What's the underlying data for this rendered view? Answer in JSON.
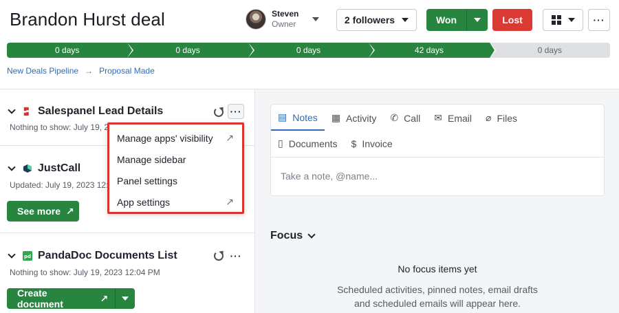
{
  "deal": {
    "title": "Brandon Hurst deal"
  },
  "owner": {
    "name": "Steven",
    "role": "Owner"
  },
  "header": {
    "followers_label": "2 followers",
    "won_label": "Won",
    "lost_label": "Lost",
    "more_label": "···"
  },
  "stages": [
    {
      "label": "0 days",
      "status": "done"
    },
    {
      "label": "0 days",
      "status": "done"
    },
    {
      "label": "0 days",
      "status": "done"
    },
    {
      "label": "42 days",
      "status": "done"
    },
    {
      "label": "0 days",
      "status": "todo"
    }
  ],
  "breadcrumb": {
    "pipeline": "New Deals Pipeline",
    "separator": "→",
    "stage": "Proposal Made"
  },
  "sidebar": {
    "sections": [
      {
        "title": "Salespanel Lead Details",
        "subtitle": "Nothing to show: July 19, 2023 12:04 PM",
        "icon_color": "#d6342e"
      },
      {
        "title": "JustCall",
        "subtitle": "Updated: July 19, 2023 12:04 PM",
        "button": "See more",
        "icon_color": "#1f3a5f"
      },
      {
        "title": "PandaDoc Documents List",
        "subtitle": "Nothing to show: July 19, 2023 12:04 PM",
        "button": "Create document",
        "icon_color": "#2fa84f"
      }
    ],
    "more_label": "···",
    "external_glyph": "↗"
  },
  "menu": {
    "items": [
      {
        "label": "Manage apps' visibility",
        "external": true
      },
      {
        "label": "Manage sidebar",
        "external": false
      },
      {
        "label": "Panel settings",
        "external": false
      },
      {
        "label": "App settings",
        "external": true
      }
    ]
  },
  "composer": {
    "tabs": [
      {
        "label": "Notes",
        "icon": "note-icon",
        "glyph": "▤",
        "active": true
      },
      {
        "label": "Activity",
        "icon": "calendar-icon",
        "glyph": "▦",
        "active": false
      },
      {
        "label": "Call",
        "icon": "phone-icon",
        "glyph": "✆",
        "active": false
      },
      {
        "label": "Email",
        "icon": "envelope-icon",
        "glyph": "✉",
        "active": false
      },
      {
        "label": "Files",
        "icon": "paperclip-icon",
        "glyph": "⌀",
        "active": false
      },
      {
        "label": "Documents",
        "icon": "document-icon",
        "glyph": "▯",
        "active": false
      },
      {
        "label": "Invoice",
        "icon": "invoice-icon",
        "glyph": "$",
        "active": false
      }
    ],
    "placeholder": "Take a note, @name..."
  },
  "focus": {
    "title": "Focus",
    "empty_title": "No focus items yet",
    "empty_line1": "Scheduled activities, pinned notes, email drafts",
    "empty_line2": "and scheduled emails will appear here."
  },
  "colors": {
    "accent_green": "#278540",
    "danger_red": "#da3a34",
    "link_blue": "#2f6bbd"
  }
}
